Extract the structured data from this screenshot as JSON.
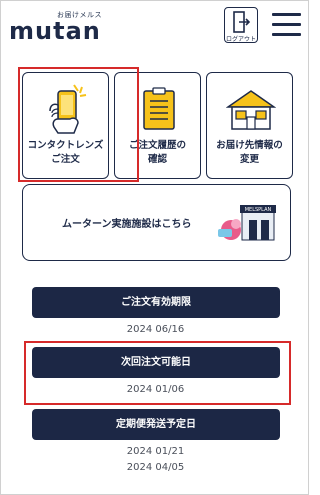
{
  "header": {
    "logo_tagline": "お届けメルス",
    "logo_word": "mutan",
    "logout_label": "ログアウト"
  },
  "tiles": [
    {
      "label": "コンタクトレンズ\nご注文",
      "icon": "hand-phone-icon"
    },
    {
      "label": "ご注文履歴の\n確認",
      "icon": "clipboard-icon"
    },
    {
      "label": "お届け先情報の\n変更",
      "icon": "house-icon"
    }
  ],
  "facility": {
    "label": "ムーターン実施施設はこちら",
    "illustration_sign": "MELSPLAN"
  },
  "sections": [
    {
      "button": "ご注文有効期限",
      "dates": [
        "2024 06/16"
      ]
    },
    {
      "button": "次回注文可能日",
      "dates": [
        "2024 01/06"
      ]
    },
    {
      "button": "定期便発送予定日",
      "dates": [
        "2024 01/21",
        "2024 04/05"
      ]
    }
  ],
  "colors": {
    "navy": "#1c2745",
    "highlight_red": "#d62a2a",
    "accent_yellow": "#f6c21a"
  }
}
